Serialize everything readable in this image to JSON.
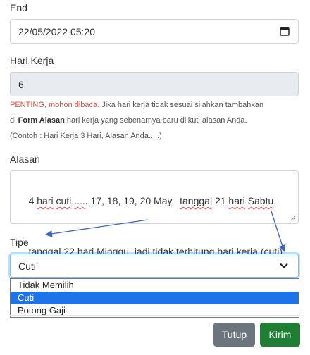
{
  "form": {
    "end": {
      "label": "End",
      "value": "22/05/2022 05:20",
      "icon": "calendar-icon"
    },
    "hari_kerja": {
      "label": "Hari Kerja",
      "value": "6"
    },
    "note": {
      "warning": "PENTING, mohon dibaca.",
      "line1_rest": " Jika hari kerja tidak sesuai silahkan tambahkan",
      "line2_prefix": "di ",
      "line2_bold": "Form Alasan",
      "line2_rest": " hari kerja yang sebenarnya baru diikuti alasan Anda.",
      "line3": "(Contoh : Hari Kerja 3 Hari, Alasan Anda.....)"
    },
    "alasan": {
      "label": "Alasan",
      "w": [
        "4 ",
        "hari",
        " ",
        "cuti",
        " ",
        "....",
        ". 17, 18, 19, 20 May,  ",
        "tanggal",
        " 21 ",
        "hari",
        " ",
        "Sabtu",
        ","
      ],
      "w2": [
        "tanggal",
        " 22 ",
        "hari",
        " ",
        "Minggu",
        ", ",
        "jadi",
        " ",
        "tidak",
        " ",
        "terhitung",
        " ",
        "hari",
        " ",
        "kerja",
        " (",
        "cuti",
        ")"
      ]
    },
    "tipe": {
      "label": "Tipe",
      "selected": "Cuti",
      "options": [
        "Tidak Memilih",
        "Cuti",
        "Potong Gaji"
      ]
    }
  },
  "buttons": {
    "tutup": "Tutup",
    "kirim": "Kirim"
  },
  "colors": {
    "warning": "#e74c3c",
    "option_highlight": "#1e73e8",
    "tutup_bg": "#6c757d",
    "kirim_bg": "#1e7e34",
    "arrow": "#3a66c4"
  }
}
